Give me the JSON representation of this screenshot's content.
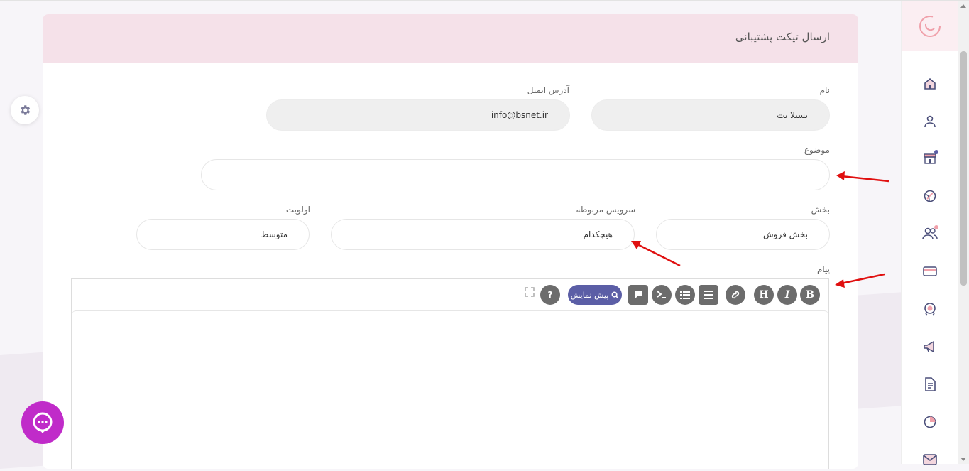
{
  "page": {
    "title": "ارسال تیکت پشتیبانی"
  },
  "form": {
    "name_label": "نام",
    "name_value": "بستلا نت",
    "email_label": "آدرس ایمیل",
    "email_value": "info@bsnet.ir",
    "subject_label": "موضوع",
    "subject_value": "",
    "department_label": "بخش",
    "department_value": "بخش فروش",
    "service_label": "سرویس مربوطه",
    "service_value": "هیچکدام",
    "priority_label": "اولویت",
    "priority_value": "متوسط",
    "message_label": "پیام"
  },
  "editor": {
    "bold": "B",
    "italic": "I",
    "heading": "H",
    "preview_label": "پیش نمایش",
    "help": "?"
  },
  "sidebar": {
    "items": [
      "home-icon",
      "user-icon",
      "store-icon",
      "globe-icon",
      "users-icon",
      "card-icon",
      "support-icon",
      "megaphone-icon",
      "document-icon",
      "pie-chart-icon",
      "mail-icon"
    ]
  },
  "colors": {
    "header_bg": "#f5e1e9",
    "accent": "#5b5ea6",
    "chat": "#c02bc9",
    "arrow": "#e01010"
  }
}
